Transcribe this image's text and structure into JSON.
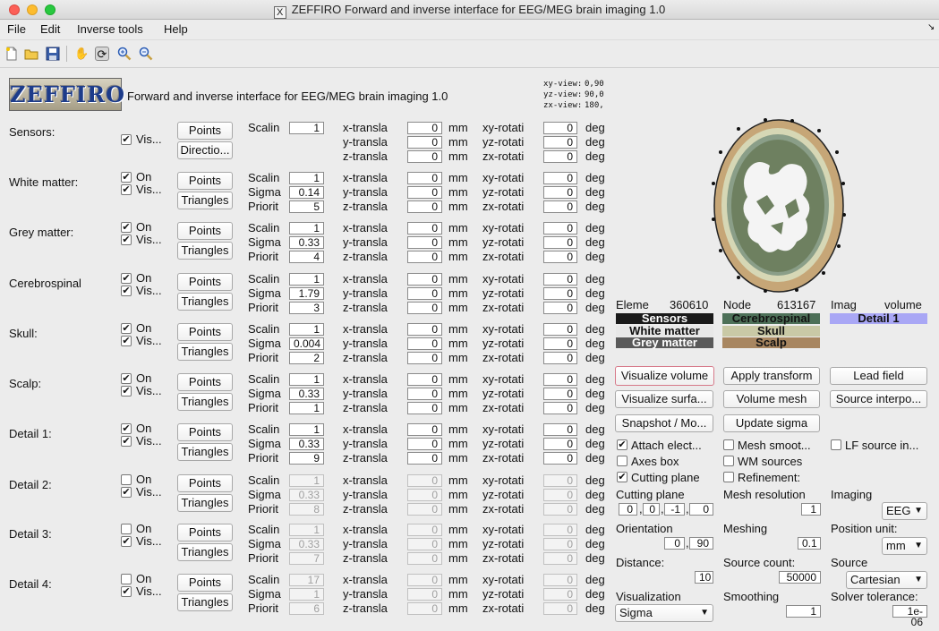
{
  "window": {
    "title": "ZEFFIRO Forward and inverse interface for EEG/MEG brain imaging 1.0",
    "app_icon_glyph": "X"
  },
  "menubar": [
    "File",
    "Edit",
    "Inverse tools",
    "Help"
  ],
  "toolbar": {
    "icons": [
      "new-file-icon",
      "open-folder-icon",
      "save-icon",
      "pan-hand-icon",
      "rotate-3d-icon",
      "zoom-in-icon",
      "zoom-out-icon"
    ]
  },
  "header": {
    "logo_text": "ZEFFIRO",
    "subtitle": "Forward and inverse interface for EEG/MEG brain imaging 1.0",
    "views": [
      {
        "label": "xy-view:",
        "value": "0,90"
      },
      {
        "label": "yz-view:",
        "value": "90,0"
      },
      {
        "label": "zx-view:",
        "value": "180,"
      }
    ]
  },
  "labels": {
    "points": "Points",
    "triangles": "Triangles",
    "directions": "Directio...",
    "on": "On",
    "vis": "Vis...",
    "scaling": "Scalin",
    "sigma": "Sigma",
    "priority": "Priorit",
    "x_trans": "x-transla",
    "y_trans": "y-transla",
    "z_trans": "z-transla",
    "xy_rot": "xy-rotati",
    "yz_rot": "yz-rotati",
    "zx_rot": "zx-rotati",
    "mm": "mm",
    "deg": "deg"
  },
  "compartments": [
    {
      "name": "Sensors:",
      "on": null,
      "vis": true,
      "scaling": "1",
      "sigma": null,
      "priority": null,
      "x": "0",
      "y": "0",
      "z": "0",
      "xy": "0",
      "yz": "0",
      "zx": "0",
      "disabled": false
    },
    {
      "name": "White matter:",
      "on": true,
      "vis": true,
      "scaling": "1",
      "sigma": "0.14",
      "priority": "5",
      "x": "0",
      "y": "0",
      "z": "0",
      "xy": "0",
      "yz": "0",
      "zx": "0",
      "disabled": false
    },
    {
      "name": "Grey matter:",
      "on": true,
      "vis": true,
      "scaling": "1",
      "sigma": "0.33",
      "priority": "4",
      "x": "0",
      "y": "0",
      "z": "0",
      "xy": "0",
      "yz": "0",
      "zx": "0",
      "disabled": false
    },
    {
      "name": "Cerebrospinal",
      "on": true,
      "vis": true,
      "scaling": "1",
      "sigma": "1.79",
      "priority": "3",
      "x": "0",
      "y": "0",
      "z": "0",
      "xy": "0",
      "yz": "0",
      "zx": "0",
      "disabled": false
    },
    {
      "name": "Skull:",
      "on": true,
      "vis": true,
      "scaling": "1",
      "sigma": "0.004",
      "priority": "2",
      "x": "0",
      "y": "0",
      "z": "0",
      "xy": "0",
      "yz": "0",
      "zx": "0",
      "disabled": false
    },
    {
      "name": "Scalp:",
      "on": true,
      "vis": true,
      "scaling": "1",
      "sigma": "0.33",
      "priority": "1",
      "x": "0",
      "y": "0",
      "z": "0",
      "xy": "0",
      "yz": "0",
      "zx": "0",
      "disabled": false
    },
    {
      "name": "Detail 1:",
      "on": true,
      "vis": true,
      "scaling": "1",
      "sigma": "0.33",
      "priority": "9",
      "x": "0",
      "y": "0",
      "z": "0",
      "xy": "0",
      "yz": "0",
      "zx": "0",
      "disabled": false
    },
    {
      "name": "Detail 2:",
      "on": false,
      "vis": true,
      "scaling": "1",
      "sigma": "0.33",
      "priority": "8",
      "x": "0",
      "y": "0",
      "z": "0",
      "xy": "0",
      "yz": "0",
      "zx": "0",
      "disabled": true
    },
    {
      "name": "Detail 3:",
      "on": false,
      "vis": true,
      "scaling": "1",
      "sigma": "0.33",
      "priority": "7",
      "x": "0",
      "y": "0",
      "z": "0",
      "xy": "0",
      "yz": "0",
      "zx": "0",
      "disabled": true
    },
    {
      "name": "Detail 4:",
      "on": false,
      "vis": true,
      "scaling": "17",
      "sigma": "1",
      "priority": "6",
      "x": "0",
      "y": "0",
      "z": "0",
      "xy": "0",
      "yz": "0",
      "zx": "0",
      "disabled": true
    }
  ],
  "stats": {
    "elements_label": "Eleme",
    "elements_value": "360610",
    "nodes_label": "Node",
    "nodes_value": "613167",
    "image_label": "Imag",
    "image_value": "volume"
  },
  "legend": {
    "sensors": {
      "label": "Sensors",
      "bg": "#1a1a1a",
      "fg": "#ffffff"
    },
    "white_matter": {
      "label": "White matter",
      "bg": "#e8e8e8",
      "fg": "#111111"
    },
    "grey_matter": {
      "label": "Grey matter",
      "bg": "#5a5a5a",
      "fg": "#ffffff"
    },
    "cerebrospinal": {
      "label": "Cerebrospinal",
      "bg": "#4d7058",
      "fg": "#111111"
    },
    "skull": {
      "label": "Skull",
      "bg": "#c9c9a6",
      "fg": "#111111"
    },
    "scalp": {
      "label": "Scalp",
      "bg": "#a88660",
      "fg": "#111111"
    },
    "detail1": {
      "label": "Detail 1",
      "bg": "#a9a7f5",
      "fg": "#111111"
    }
  },
  "actions": {
    "visualize_volume": "Visualize volume",
    "apply_transform": "Apply transform",
    "lead_field": "Lead field",
    "visualize_surface": "Visualize surfa...",
    "volume_mesh": "Volume mesh",
    "source_interp": "Source interpo...",
    "snapshot": "Snapshot / Mo...",
    "update_sigma": "Update sigma"
  },
  "options": {
    "attach_electrodes": {
      "label": "Attach elect...",
      "checked": true
    },
    "mesh_smoothing": {
      "label": "Mesh smoot...",
      "checked": false
    },
    "lf_source": {
      "label": "LF source in...",
      "checked": false
    },
    "axes_box": {
      "label": "Axes box",
      "checked": false
    },
    "wm_sources": {
      "label": "WM sources",
      "checked": false
    },
    "cutting_plane": {
      "label": "Cutting plane",
      "checked": true
    },
    "refinement": {
      "label": "Refinement:",
      "checked": false
    }
  },
  "params": {
    "cutting_plane_label": "Cutting plane",
    "cutting_plane_values": [
      "0",
      "0",
      "-1",
      "0"
    ],
    "mesh_resolution_label": "Mesh resolution",
    "mesh_resolution_value": "1",
    "imaging_label": "Imaging",
    "imaging_value": "EEG",
    "orientation_label": "Orientation",
    "orientation_values": [
      "0",
      "90"
    ],
    "meshing_label": "Meshing",
    "meshing_value": "0.1",
    "position_unit_label": "Position unit:",
    "position_unit_value": "mm",
    "distance_label": "Distance:",
    "distance_value": "10",
    "source_count_label": "Source count:",
    "source_count_value": "50000",
    "source_label": "Source",
    "source_value": "Cartesian",
    "visualization_label": "Visualization",
    "visualization_value": "Sigma",
    "smoothing_label": "Smoothing",
    "smoothing_value": "1",
    "solver_tolerance_label": "Solver tolerance:",
    "solver_tolerance_value": "1e-06"
  }
}
